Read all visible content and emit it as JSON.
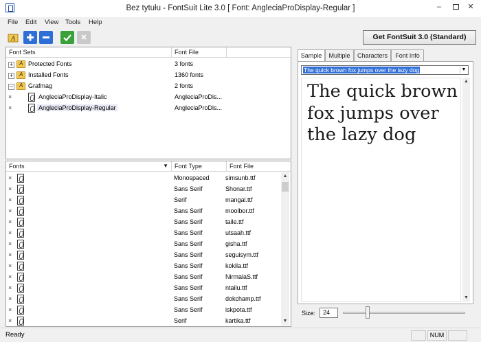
{
  "window": {
    "title": "Bez tytułu - FontSuit Lite 3.0  [ Font:  AngleciaProDisplay-Regular ]",
    "min_glyph": "–",
    "close_glyph": "✕"
  },
  "menu": [
    "File",
    "Edit",
    "View",
    "Tools",
    "Help"
  ],
  "toolbar": {
    "buttons": [
      "open-folder-icon",
      "add-icon",
      "remove-icon",
      "check-icon",
      "delete-icon"
    ],
    "get_button_label": "Get FontSuit 3.0 (Standard)"
  },
  "font_sets": {
    "headers": [
      "Font Sets",
      "Font File"
    ],
    "rows": [
      {
        "label": "Protected Fonts",
        "file": "3 fonts",
        "expander": "+"
      },
      {
        "label": "Installed Fonts",
        "file": "1360 fonts",
        "expander": "+"
      },
      {
        "label": "Grafmag",
        "file": "2 fonts",
        "expander": "−"
      },
      {
        "label": "AngleciaProDisplay-Italic",
        "file": "AngleciaProDis..."
      },
      {
        "label": "AngleciaProDisplay-Regular",
        "file": "AngleciaProDis..."
      }
    ]
  },
  "fonts_list": {
    "headers": [
      "Fonts",
      "Font Type",
      "Font File"
    ],
    "rows": [
      {
        "type": "Monospaced",
        "file": "simsunb.ttf"
      },
      {
        "type": "Sans Serif",
        "file": "Shonar.ttf"
      },
      {
        "type": "Serif",
        "file": "mangal.ttf"
      },
      {
        "type": "Sans Serif",
        "file": "moolbor.ttf"
      },
      {
        "type": "Sans Serif",
        "file": "taile.ttf"
      },
      {
        "type": "Sans Serif",
        "file": "utsaah.ttf"
      },
      {
        "type": "Sans Serif",
        "file": "gisha.ttf"
      },
      {
        "type": "Sans Serif",
        "file": "seguisym.ttf"
      },
      {
        "type": "Sans Serif",
        "file": "kokila.ttf"
      },
      {
        "type": "Sans Serif",
        "file": "NirmalaS.ttf"
      },
      {
        "type": "Sans Serif",
        "file": "ntailu.ttf"
      },
      {
        "type": "Sans Serif",
        "file": "dokchamp.ttf"
      },
      {
        "type": "Sans Serif",
        "file": "iskpota.ttf"
      },
      {
        "type": "Serif",
        "file": "kartika.ttf"
      }
    ]
  },
  "preview": {
    "tabs": [
      "Sample",
      "Multiple",
      "Characters",
      "Font Info"
    ],
    "sample_text_option": "The quick brown fox jumps over the lazy dog",
    "preview_lines": [
      "The quick brown",
      "fox jumps over",
      "the lazy dog"
    ],
    "size_label": "Size:",
    "size_value": "24"
  },
  "status": {
    "text": "Ready",
    "num": "NUM"
  }
}
